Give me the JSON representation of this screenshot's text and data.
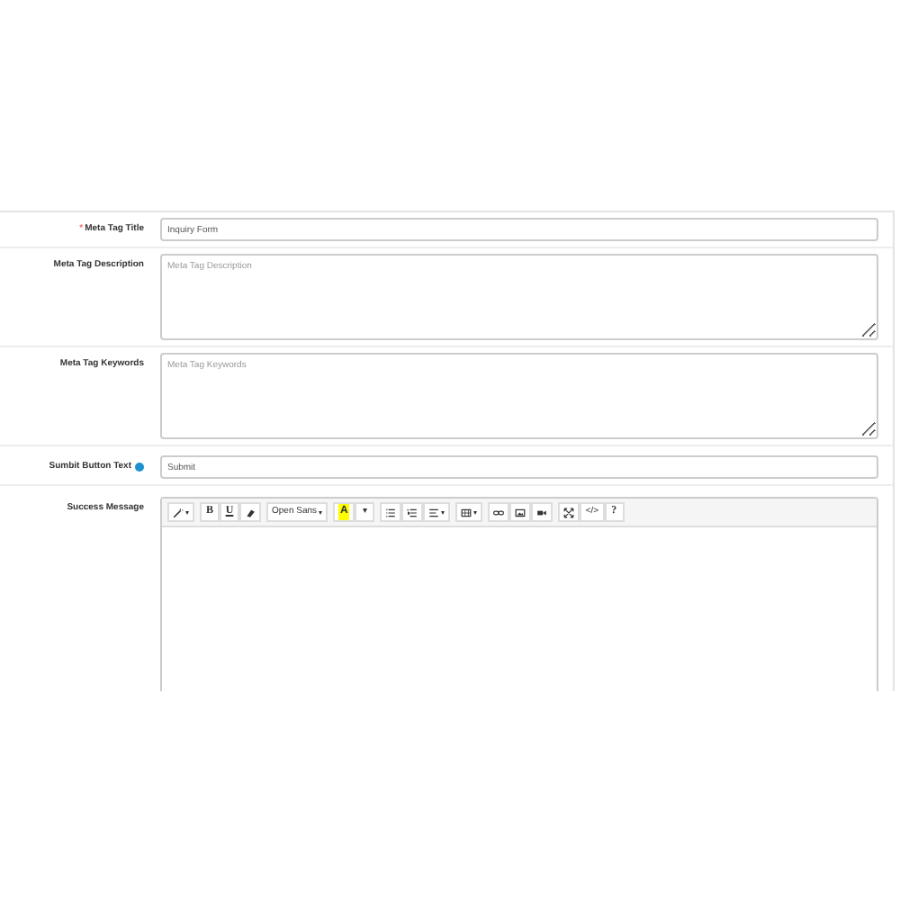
{
  "fields": [
    {
      "kind": "input",
      "label": "Meta Tag Title",
      "required_mark": "*",
      "value": "Inquiry Form"
    },
    {
      "kind": "textarea",
      "label": "Meta Tag Description",
      "placeholder": "Meta Tag Description"
    },
    {
      "kind": "textarea",
      "label": "Meta Tag Keywords",
      "placeholder": "Meta Tag Keywords"
    },
    {
      "kind": "input",
      "label": "Sumbit Button Text",
      "help": true,
      "value": "Submit"
    },
    {
      "kind": "editor",
      "label": "Success Message",
      "toolbar": [
        [
          {
            "kind": "magic",
            "caret": true
          }
        ],
        [
          {
            "kind": "bold",
            "text": "B"
          },
          {
            "kind": "underline",
            "text": "U"
          },
          {
            "kind": "eraser"
          }
        ],
        [
          {
            "kind": "font",
            "text": "Open Sans",
            "caret": true
          }
        ],
        [
          {
            "kind": "highlight",
            "text": "A"
          },
          {
            "kind": "plain",
            "text": "▾"
          }
        ],
        [
          {
            "kind": "bullets"
          },
          {
            "kind": "numbers"
          },
          {
            "kind": "align",
            "caret": true
          }
        ],
        [
          {
            "kind": "table",
            "caret": true
          }
        ],
        [
          {
            "kind": "link"
          },
          {
            "kind": "image"
          },
          {
            "kind": "video"
          }
        ],
        [
          {
            "kind": "expand"
          },
          {
            "kind": "plain",
            "text": "</>"
          },
          {
            "kind": "bold",
            "text": "?"
          }
        ]
      ]
    }
  ]
}
